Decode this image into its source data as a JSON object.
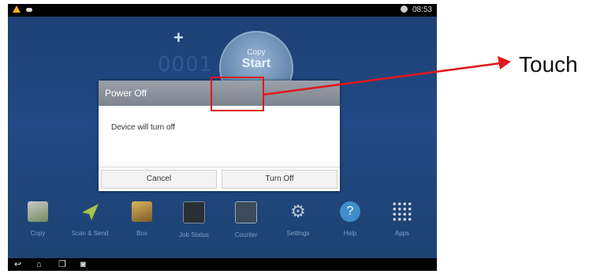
{
  "status_bar": {
    "time": "08:53"
  },
  "home": {
    "counter_digits": "0001",
    "start_button": {
      "small_label": "Copy",
      "big_label": "Start"
    }
  },
  "dialog": {
    "title": "Power Off",
    "message": "Device will turn off",
    "cancel_label": "Cancel",
    "confirm_label": "Turn Off"
  },
  "dock": [
    {
      "label": "Copy",
      "icon": "copy-icon"
    },
    {
      "label": "Scan & Send",
      "icon": "scan-send-icon"
    },
    {
      "label": "Box",
      "icon": "box-icon"
    },
    {
      "label": "Job Status",
      "icon": "job-status-icon"
    },
    {
      "label": "Counter",
      "icon": "counter-icon"
    },
    {
      "label": "Settings",
      "icon": "gear-icon"
    },
    {
      "label": "Help",
      "icon": "help-icon"
    },
    {
      "label": "Apps",
      "icon": "apps-grid-icon"
    }
  ],
  "annotation": {
    "label": "Touch",
    "color": "#e0161c"
  }
}
